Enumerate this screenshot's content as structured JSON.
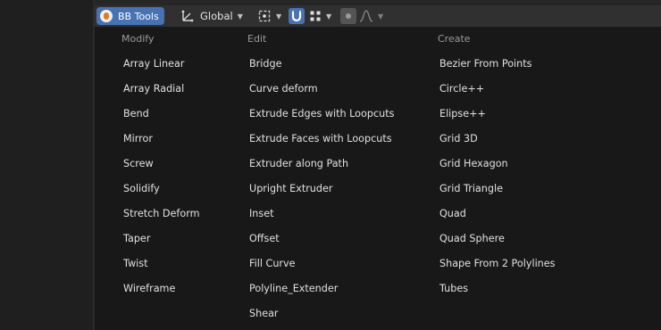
{
  "header": {
    "addon_button": "BB Tools",
    "orientation": "Global"
  },
  "menu": {
    "columns": [
      {
        "heading": "Modify",
        "items": [
          "Array Linear",
          "Array Radial",
          "Bend",
          "Mirror",
          "Screw",
          "Solidify",
          "Stretch Deform",
          "Taper",
          "Twist",
          "Wireframe"
        ]
      },
      {
        "heading": "Edit",
        "items": [
          "Bridge",
          "Curve deform",
          "Extrude Edges with Loopcuts",
          "Extrude Faces with Loopcuts",
          "Extruder along Path",
          "Upright Extruder",
          "Inset",
          "Offset",
          "Fill Curve",
          "Polyline_Extender",
          "Shear"
        ]
      },
      {
        "heading": "Create",
        "items": [
          "Bezier From Points",
          "Circle++",
          "Elipse++",
          "Grid 3D",
          "Grid Hexagon",
          "Grid Triangle",
          "Quad",
          "Quad Sphere",
          "Shape From 2 Polylines",
          "Tubes"
        ]
      }
    ]
  },
  "colors": {
    "accent": "#4772b3",
    "header_bg": "#303030",
    "menu_bg": "#181818"
  }
}
